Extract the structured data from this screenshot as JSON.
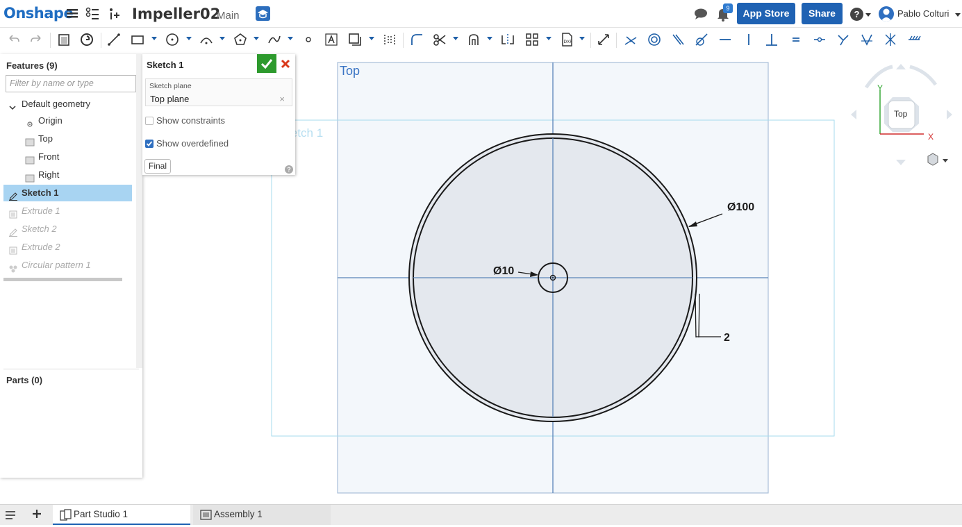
{
  "header": {
    "logo": "Onshape",
    "doc_title": "Impeller02",
    "branch": "Main",
    "notification_count": "9",
    "app_store": "App Store",
    "share": "Share",
    "help": "?",
    "user": "Pablo Colturi"
  },
  "feature_panel": {
    "title": "Features (9)",
    "filter_placeholder": "Filter by name or type",
    "items": [
      {
        "label": "Default geometry",
        "icon": "chevron-down-icon",
        "state": "normal"
      },
      {
        "label": "Origin",
        "icon": "origin-icon",
        "state": "normal"
      },
      {
        "label": "Top",
        "icon": "plane-icon",
        "state": "normal"
      },
      {
        "label": "Front",
        "icon": "plane-icon",
        "state": "normal"
      },
      {
        "label": "Right",
        "icon": "plane-icon",
        "state": "normal"
      },
      {
        "label": "Sketch 1",
        "icon": "sketch-icon",
        "state": "selected"
      },
      {
        "label": "Extrude 1",
        "icon": "extrude-icon",
        "state": "rolled-back"
      },
      {
        "label": "Sketch 2",
        "icon": "sketch-icon",
        "state": "rolled-back"
      },
      {
        "label": "Extrude 2",
        "icon": "extrude-icon",
        "state": "rolled-back"
      },
      {
        "label": "Circular pattern 1",
        "icon": "pattern-icon",
        "state": "rolled-back"
      }
    ],
    "parts_title": "Parts (0)"
  },
  "sketch_dialog": {
    "title": "Sketch 1",
    "plane_label": "Sketch plane",
    "plane_value": "Top plane",
    "clear": "×",
    "show_constraints": "Show constraints",
    "show_constraints_checked": false,
    "show_overdefined": "Show overdefined",
    "show_overdefined_checked": true,
    "final": "Final",
    "help": "?"
  },
  "viewport": {
    "plane_label": "Top",
    "sketch_label": "Sketch 1",
    "dim_outer": "Ø100",
    "dim_hole": "Ø10",
    "dim_offset": "2",
    "view_cube_label": "Top",
    "axis_y": "Y",
    "axis_x": "X"
  },
  "tabs": [
    {
      "label": "Part Studio 1",
      "active": true
    },
    {
      "label": "Assembly 1",
      "active": false
    }
  ],
  "colors": {
    "brand": "#1f6dc2",
    "button_blue": "#1f62b3",
    "selection": "#a8d4f2",
    "confirm_green": "#2d9a2d",
    "cancel_red": "#d9391b",
    "plane_fill": "#f3f7fb",
    "plane_stroke": "#a9bfd8",
    "sketch_fill": "#e4e8ee"
  }
}
